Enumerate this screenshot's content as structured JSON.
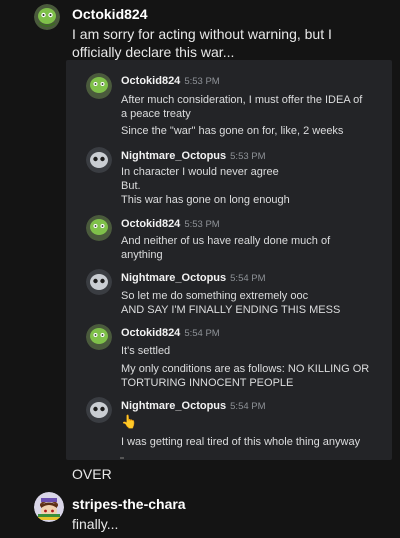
{
  "op": {
    "username": "Octokid824",
    "text_lines": [
      "I am sorry for acting without warning, but I",
      "officially declare this war..."
    ]
  },
  "messages": [
    {
      "author": "Octokid824",
      "time": "5:53 PM",
      "lines": [
        "After much consideration, I must offer the IDEA of",
        "a peace treaty",
        "Since the \"war\" has gone on for, like, 2 weeks"
      ]
    },
    {
      "author": "Nightmare_Octopus",
      "time": "5:53 PM",
      "lines": [
        "In character I would never agree",
        "But.",
        "This war has gone on long enough"
      ]
    },
    {
      "author": "Octokid824",
      "time": "5:53 PM",
      "lines": [
        "And neither of us have really done much of",
        "anything"
      ]
    },
    {
      "author": "Nightmare_Octopus",
      "time": "5:54 PM",
      "lines": [
        "So let me do something extremely ooc",
        "AND SAY I'M FINALLY ENDING THIS MESS"
      ]
    },
    {
      "author": "Octokid824",
      "time": "5:54 PM",
      "lines": [
        "It's settled",
        "My only conditions are as follows: NO KILLING OR",
        "TORTURING INNOCENT PEOPLE"
      ]
    },
    {
      "author": "Nightmare_Octopus",
      "time": "5:54 PM",
      "emoji": "👆",
      "lines": [
        "I was getting real tired of this whole thing anyway"
      ]
    }
  ],
  "over_text": "OVER",
  "reply": {
    "username": "stripes-the-chara",
    "text": "finally..."
  },
  "colors": {
    "background": "#141414",
    "screenshot_bg": "#232427",
    "timestamp": "#8e9297"
  },
  "icons": {
    "octokid_avatar": "green-octopus-avatar",
    "nightmare_avatar": "dark-octopus-avatar",
    "stripes_avatar": "chara-avatar"
  }
}
